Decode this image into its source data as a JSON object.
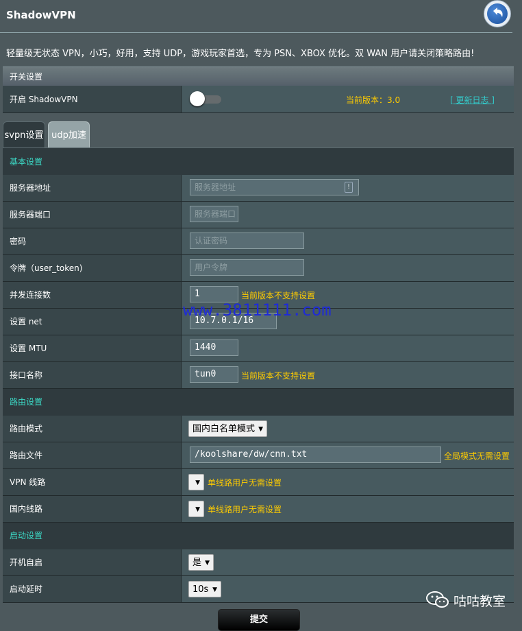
{
  "header": {
    "title": "ShadowVPN",
    "description": "轻量级无状态 VPN，小巧，好用，支持 UDP，游戏玩家首选，专为 PSN、XBOX 优化。双 WAN 用户请关闭策略路由!"
  },
  "switch_section": {
    "header": "开关设置",
    "enable_label": "开启 ShadowVPN",
    "version_text": "当前版本：3.0",
    "changelog_link": "[ 更新日志 ]",
    "enabled": false
  },
  "tabs": [
    {
      "label": "svpn设置",
      "active": true
    },
    {
      "label": "udp加速",
      "active": false
    }
  ],
  "basic": {
    "header": "基本设置",
    "rows": [
      {
        "label": "服务器地址",
        "placeholder": "服务器地址"
      },
      {
        "label": "服务器端口",
        "placeholder": "服务器端口"
      },
      {
        "label": "密码",
        "placeholder": "认证密码"
      },
      {
        "label": "令牌（user_token)",
        "placeholder": "用户令牌"
      },
      {
        "label": "并发连接数",
        "value": "1",
        "hint": "当前版本不支持设置"
      },
      {
        "label": "设置 net",
        "value": "10.7.0.1/16"
      },
      {
        "label": "设置 MTU",
        "value": "1440"
      },
      {
        "label": "接口名称",
        "value": "tun0",
        "hint": "当前版本不支持设置"
      }
    ]
  },
  "routing": {
    "header": "路由设置",
    "mode_label": "路由模式",
    "mode_value": "国内白名单模式",
    "file_label": "路由文件",
    "file_value": "/koolshare/dw/cnn.txt",
    "file_hint": "全局模式无需设置",
    "vpn_line_label": "VPN 线路",
    "vpn_line_hint": "单线路用户无需设置",
    "domestic_line_label": "国内线路",
    "domestic_line_hint": "单线路用户无需设置"
  },
  "startup": {
    "header": "启动设置",
    "autostart_label": "开机自启",
    "autostart_value": "是",
    "delay_label": "启动延时",
    "delay_value": "10s"
  },
  "watermark": "www.3811111.com",
  "wechat_label": "咕咕教室",
  "submit_label": "提交"
}
